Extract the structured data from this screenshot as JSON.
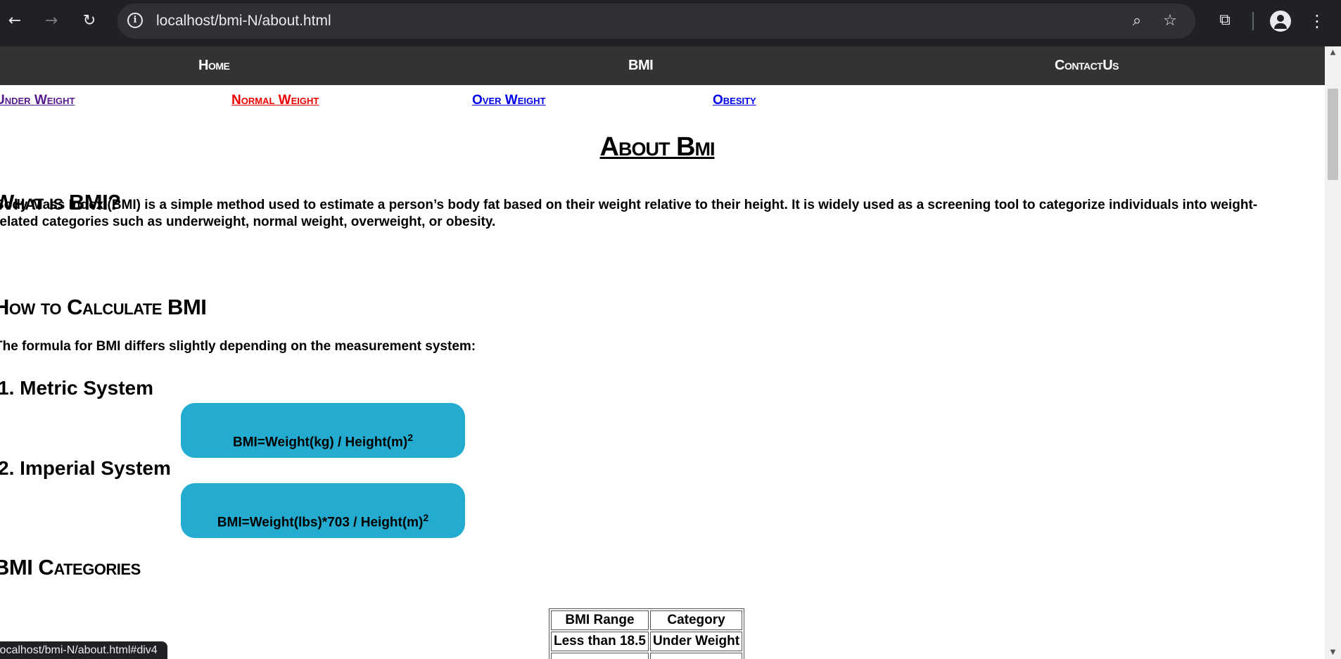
{
  "browser": {
    "url": "localhost/bmi-N/about.html",
    "status_url": "localhost/bmi-N/about.html#div4",
    "icons": {
      "back": "arrow-left-icon",
      "forward": "arrow-right-icon",
      "reload": "reload-icon",
      "site_info": "info-icon",
      "zoom": "zoom-out-icon",
      "bookmark": "star-icon",
      "extensions": "puzzle-icon",
      "profile": "profile-icon",
      "menu": "kebab-menu-icon"
    }
  },
  "nav": {
    "items": [
      {
        "label": "Home"
      },
      {
        "label": "BMI"
      },
      {
        "label": "ContactUs"
      }
    ]
  },
  "categories": {
    "links": [
      {
        "label": "Under Weight",
        "state": "visited"
      },
      {
        "label": "Normal Weight",
        "state": "active"
      },
      {
        "label": "Over Weight",
        "state": "default"
      },
      {
        "label": "Obesity",
        "state": "default"
      }
    ]
  },
  "page": {
    "title": "About Bmi",
    "what_heading": "What is BMI?",
    "what_text_1": "Body Mass Index (BMI) is a simple method used to estimate a person’s body fat based on their weight relative to their height. It is widely used as a screening tool to categorize individuals into weight-",
    "what_text_2": "related categories such as underweight, normal weight, overweight, or obesity.",
    "how_heading": "How to Calculate BMI",
    "how_text": "The formula for BMI differs slightly depending on the measurement system:",
    "metric_heading": "1. Metric System",
    "metric_formula": "BMI=Weight(kg) / Height(m)",
    "metric_exp": "2",
    "imperial_heading": "2. Imperial System",
    "imperial_formula": "BMI=Weight(lbs)*703 / Height(m)",
    "imperial_exp": "2",
    "categories_heading": "BMI Categories"
  },
  "table": {
    "headers": [
      "BMI Range",
      "Category"
    ],
    "rows": [
      [
        "Less than 18.5",
        "Under Weight"
      ]
    ]
  },
  "colors": {
    "nav_bg": "#333333",
    "formula_bg": "#23acd0",
    "link_visited": "#551a8b",
    "link_active": "#ee0000",
    "link_default": "#0000ee"
  }
}
